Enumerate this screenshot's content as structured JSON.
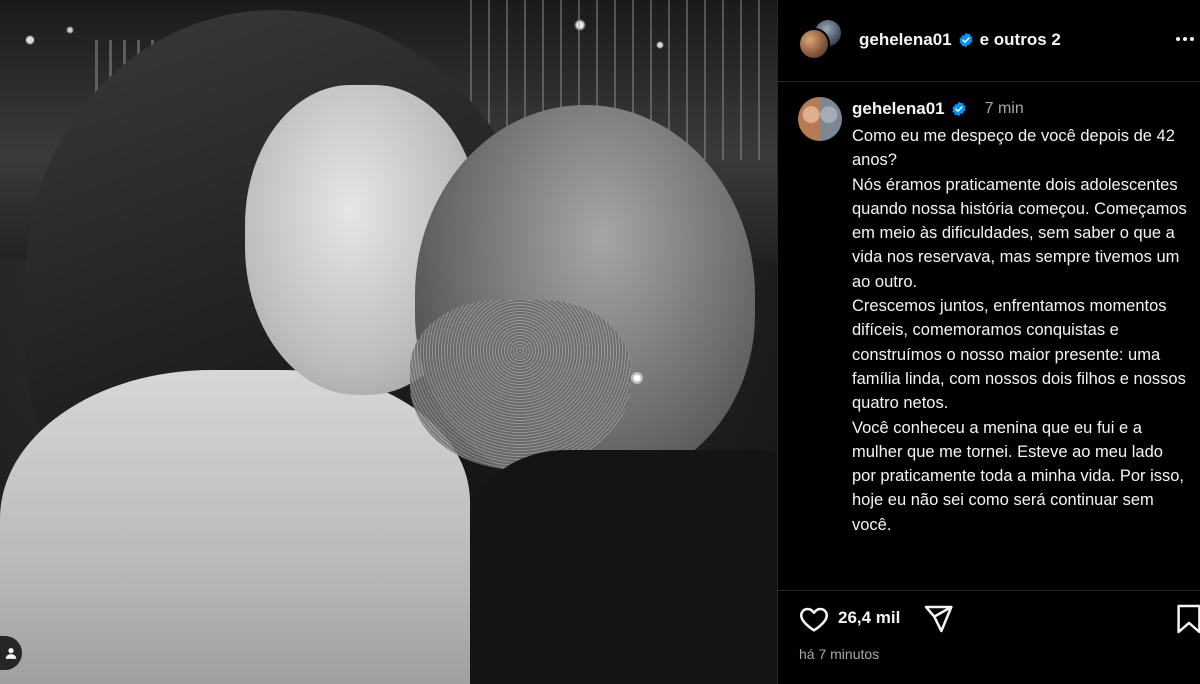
{
  "post": {
    "header": {
      "username": "gehelena01",
      "coauthors": "e outros 2"
    },
    "caption": {
      "username": "gehelena01",
      "time_ago": "7 min",
      "paragraphs": [
        "Como eu me despeço de você depois de 42 anos?",
        "Nós éramos praticamente dois adolescentes quando nossa história começou. Começamos em meio às dificuldades, sem saber o que a vida nos reservava, mas sempre tivemos um ao outro.",
        "Crescemos juntos, enfrentamos momentos difíceis, comemoramos conquistas e construímos o nosso maior presente: uma família linda, com nossos dois filhos e nossos quatro netos.",
        "Você conheceu a menina que eu fui e a mulher que me tornei. Esteve ao meu lado por praticamente toda a minha vida. Por isso, hoje eu não sei como será continuar sem você."
      ]
    },
    "actions": {
      "likes": "26,4 mil",
      "timestamp": "há 7 minutos"
    }
  },
  "icons": {
    "verified": "verified-badge-icon",
    "more": "more-options-icon",
    "like": "heart-icon",
    "share": "paper-plane-icon",
    "save": "bookmark-icon",
    "tagged_users": "user-icon"
  },
  "colors": {
    "background": "#000000",
    "text": "#f5f5f5",
    "muted": "#a8a8a8",
    "verified": "#0095f6",
    "divider": "#262626"
  }
}
